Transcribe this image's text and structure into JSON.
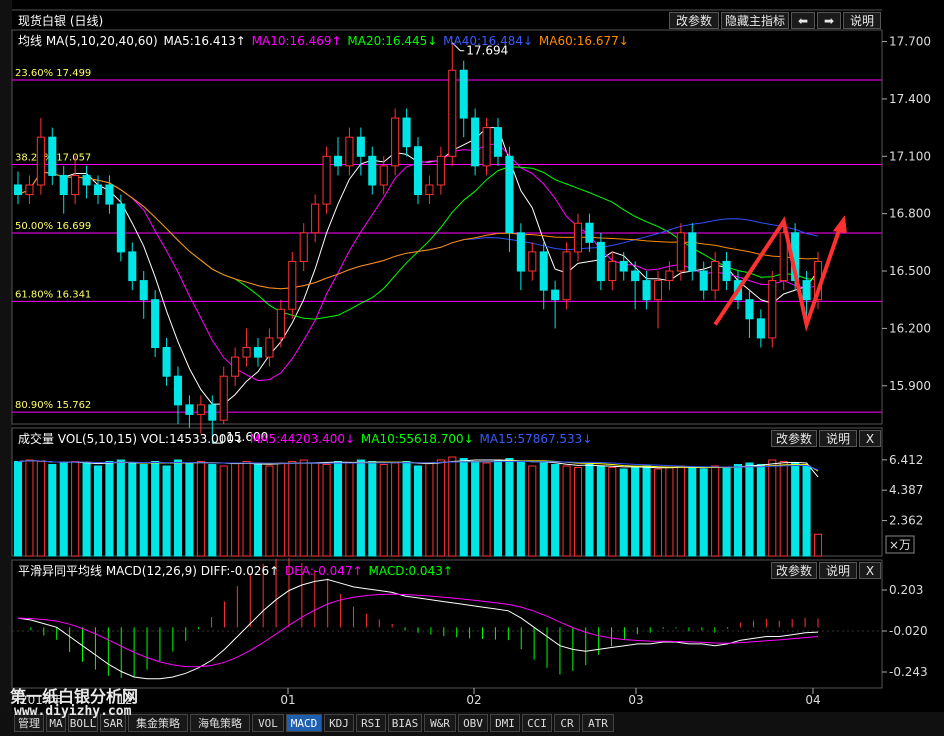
{
  "main": {
    "title": "现货白银 (日线)",
    "buttons": [
      "改参数",
      "隐藏主指标",
      "⬅",
      "➡",
      "说明"
    ],
    "ma_legend": {
      "label": "均线 MA(5,10,20,40,60)",
      "ma5": "MA5:16.413↑",
      "ma10": "MA10:16.469↑",
      "ma20": "MA20:16.445↓",
      "ma40": "MA40:16.484↓",
      "ma60": "MA60:16.677↓"
    },
    "fib_labels": [
      "23.60% 17.499",
      "38.20% 17.057",
      "50.00% 16.699",
      "61.80% 16.341",
      "80.90% 15.762"
    ],
    "high_label": "17.694",
    "low_label": "15.600",
    "y_ticks": [
      "17.700",
      "17.400",
      "17.100",
      "16.800",
      "16.500",
      "16.200",
      "15.900"
    ]
  },
  "volume": {
    "legend": {
      "label": "成交量 VOL(5,10,15) VOL:14533.000↓",
      "ma5": "MA5:44203.400↓",
      "ma10": "MA10:55618.700↓",
      "ma15": "MA15:57867.533↓"
    },
    "buttons": [
      "改参数",
      "说明",
      "X"
    ],
    "y_ticks": [
      "6.412",
      "4.387",
      "2.362"
    ],
    "unit": "×万"
  },
  "macd": {
    "legend": {
      "label": "平滑异同平均线 MACD(12,26,9) DIFF:-0.026↑",
      "dea": "DEA:-0.047↑",
      "macd": "MACD:0.043↑"
    },
    "buttons": [
      "改参数",
      "说明",
      "X"
    ],
    "y_ticks": [
      "0.203",
      "-0.020",
      "-0.243"
    ]
  },
  "x_axis": {
    "labels": [
      "2017年",
      "12",
      "01",
      "02",
      "03",
      "04"
    ]
  },
  "tabs": [
    "管理",
    "MA",
    "BOLL",
    "SAR",
    "集金策略",
    "海龟策略",
    "VOL",
    "MACD",
    "KDJ",
    "RSI",
    "BIAS",
    "W&R",
    "OBV",
    "DMI",
    "CCI",
    "CR",
    "ATR"
  ],
  "active_tab": "MACD",
  "watermark": {
    "line1": "第一纸白银分析网",
    "line2": "www.diyizhy.com"
  },
  "colors": {
    "up": "#ff3232",
    "down": "#00e5e5",
    "fib": "#ff00ff",
    "ma5": "#ffffff",
    "ma10": "#ff00ff",
    "ma20": "#00ff00",
    "ma40": "#3050ff",
    "ma60": "#ff8c00",
    "diff": "#ffffff",
    "dea": "#ff00ff"
  },
  "chart_data": {
    "type": "candlestick",
    "instrument": "现货白银",
    "period": "日线",
    "price_ylim": [
      15.7,
      17.75
    ],
    "fib_levels": [
      {
        "pct": "23.60%",
        "price": 17.499
      },
      {
        "pct": "38.20%",
        "price": 17.057
      },
      {
        "pct": "50.00%",
        "price": 16.699
      },
      {
        "pct": "61.80%",
        "price": 16.341
      },
      {
        "pct": "80.90%",
        "price": 15.762
      }
    ],
    "high": 17.694,
    "low": 15.6,
    "candles": [
      [
        16.95,
        16.9,
        17.02,
        16.85
      ],
      [
        16.9,
        16.95,
        17.0,
        16.85
      ],
      [
        16.95,
        17.2,
        17.3,
        16.9
      ],
      [
        17.2,
        17.0,
        17.25,
        16.95
      ],
      [
        17.0,
        16.9,
        17.05,
        16.8
      ],
      [
        16.9,
        17.0,
        17.1,
        16.85
      ],
      [
        17.0,
        16.95,
        17.05,
        16.88
      ],
      [
        16.95,
        16.9,
        17.0,
        16.85
      ],
      [
        16.95,
        16.85,
        17.0,
        16.8
      ],
      [
        16.85,
        16.6,
        16.9,
        16.55
      ],
      [
        16.6,
        16.45,
        16.65,
        16.4
      ],
      [
        16.45,
        16.35,
        16.5,
        16.25
      ],
      [
        16.35,
        16.1,
        16.4,
        16.05
      ],
      [
        16.1,
        15.95,
        16.15,
        15.9
      ],
      [
        15.95,
        15.8,
        16.0,
        15.7
      ],
      [
        15.8,
        15.75,
        15.85,
        15.68
      ],
      [
        15.75,
        15.8,
        15.85,
        15.65
      ],
      [
        15.8,
        15.72,
        15.85,
        15.6
      ],
      [
        15.72,
        15.95,
        16.0,
        15.7
      ],
      [
        15.95,
        16.05,
        16.1,
        15.9
      ],
      [
        16.05,
        16.1,
        16.2,
        16.0
      ],
      [
        16.1,
        16.05,
        16.15,
        16.0
      ],
      [
        16.05,
        16.15,
        16.2,
        16.0
      ],
      [
        16.15,
        16.3,
        16.35,
        16.1
      ],
      [
        16.3,
        16.55,
        16.6,
        16.25
      ],
      [
        16.55,
        16.7,
        16.75,
        16.5
      ],
      [
        16.7,
        16.85,
        16.9,
        16.65
      ],
      [
        16.85,
        17.1,
        17.15,
        16.8
      ],
      [
        17.1,
        17.05,
        17.2,
        17.0
      ],
      [
        17.05,
        17.2,
        17.25,
        17.0
      ],
      [
        17.2,
        17.1,
        17.25,
        17.0
      ],
      [
        17.1,
        16.95,
        17.15,
        16.9
      ],
      [
        16.95,
        17.05,
        17.1,
        16.9
      ],
      [
        17.05,
        17.3,
        17.35,
        17.0
      ],
      [
        17.3,
        17.15,
        17.35,
        17.1
      ],
      [
        17.15,
        16.9,
        17.2,
        16.85
      ],
      [
        16.9,
        16.95,
        17.0,
        16.85
      ],
      [
        16.95,
        17.1,
        17.15,
        16.9
      ],
      [
        17.1,
        17.55,
        17.69,
        17.05
      ],
      [
        17.55,
        17.3,
        17.6,
        17.2
      ],
      [
        17.3,
        17.05,
        17.35,
        17.0
      ],
      [
        17.05,
        17.25,
        17.3,
        17.0
      ],
      [
        17.25,
        17.1,
        17.3,
        17.05
      ],
      [
        17.1,
        16.7,
        17.15,
        16.6
      ],
      [
        16.7,
        16.5,
        16.75,
        16.4
      ],
      [
        16.5,
        16.6,
        16.65,
        16.45
      ],
      [
        16.6,
        16.4,
        16.65,
        16.3
      ],
      [
        16.4,
        16.35,
        16.45,
        16.2
      ],
      [
        16.35,
        16.6,
        16.65,
        16.3
      ],
      [
        16.6,
        16.75,
        16.8,
        16.55
      ],
      [
        16.75,
        16.65,
        16.8,
        16.6
      ],
      [
        16.65,
        16.45,
        16.7,
        16.4
      ],
      [
        16.45,
        16.55,
        16.6,
        16.4
      ],
      [
        16.55,
        16.5,
        16.6,
        16.45
      ],
      [
        16.5,
        16.45,
        16.55,
        16.3
      ],
      [
        16.45,
        16.35,
        16.5,
        16.3
      ],
      [
        16.35,
        16.45,
        16.5,
        16.2
      ],
      [
        16.45,
        16.5,
        16.55,
        16.4
      ],
      [
        16.5,
        16.7,
        16.75,
        16.45
      ],
      [
        16.7,
        16.5,
        16.75,
        16.45
      ],
      [
        16.5,
        16.4,
        16.55,
        16.35
      ],
      [
        16.4,
        16.55,
        16.6,
        16.35
      ],
      [
        16.55,
        16.45,
        16.6,
        16.4
      ],
      [
        16.45,
        16.35,
        16.5,
        16.3
      ],
      [
        16.35,
        16.25,
        16.4,
        16.15
      ],
      [
        16.25,
        16.15,
        16.3,
        16.1
      ],
      [
        16.15,
        16.45,
        16.5,
        16.1
      ],
      [
        16.45,
        16.7,
        16.75,
        16.4
      ],
      [
        16.7,
        16.45,
        16.75,
        16.4
      ],
      [
        16.45,
        16.35,
        16.5,
        16.2
      ],
      [
        16.35,
        16.55,
        16.6,
        16.3
      ]
    ],
    "volume_ylim": [
      0,
      7.2
    ],
    "volume": [
      6.3,
      6.4,
      6.3,
      6.1,
      6.2,
      6.3,
      6.2,
      6.0,
      6.3,
      6.4,
      6.2,
      6.1,
      6.3,
      6.0,
      6.4,
      6.2,
      6.3,
      6.1,
      6.0,
      6.2,
      6.3,
      6.1,
      6.0,
      6.2,
      6.3,
      6.4,
      6.2,
      6.1,
      6.3,
      6.2,
      6.4,
      6.3,
      6.1,
      6.2,
      6.3,
      6.0,
      6.2,
      6.4,
      6.6,
      6.5,
      6.3,
      6.2,
      6.4,
      6.5,
      6.3,
      6.0,
      6.2,
      6.1,
      6.0,
      5.9,
      6.1,
      6.0,
      5.9,
      5.8,
      5.9,
      6.0,
      5.8,
      5.9,
      6.0,
      5.9,
      5.8,
      6.0,
      5.9,
      6.1,
      6.2,
      6.1,
      6.4,
      6.3,
      6.2,
      6.0,
      1.45
    ],
    "macd_ylim": [
      -0.33,
      0.29
    ],
    "diff": [
      0.05,
      0.04,
      0.02,
      0.0,
      -0.05,
      -0.1,
      -0.15,
      -0.2,
      -0.24,
      -0.27,
      -0.28,
      -0.28,
      -0.27,
      -0.25,
      -0.22,
      -0.18,
      -0.12,
      -0.05,
      0.02,
      0.09,
      0.15,
      0.2,
      0.23,
      0.25,
      0.26,
      0.24,
      0.22,
      0.21,
      0.2,
      0.19,
      0.17,
      0.16,
      0.15,
      0.14,
      0.13,
      0.12,
      0.11,
      0.1,
      0.09,
      0.05,
      0.0,
      -0.05,
      -0.1,
      -0.12,
      -0.13,
      -0.12,
      -0.11,
      -0.1,
      -0.09,
      -0.09,
      -0.08,
      -0.08,
      -0.09,
      -0.09,
      -0.1,
      -0.09,
      -0.07,
      -0.06,
      -0.05,
      -0.05,
      -0.04,
      -0.03,
      -0.026
    ]
  }
}
